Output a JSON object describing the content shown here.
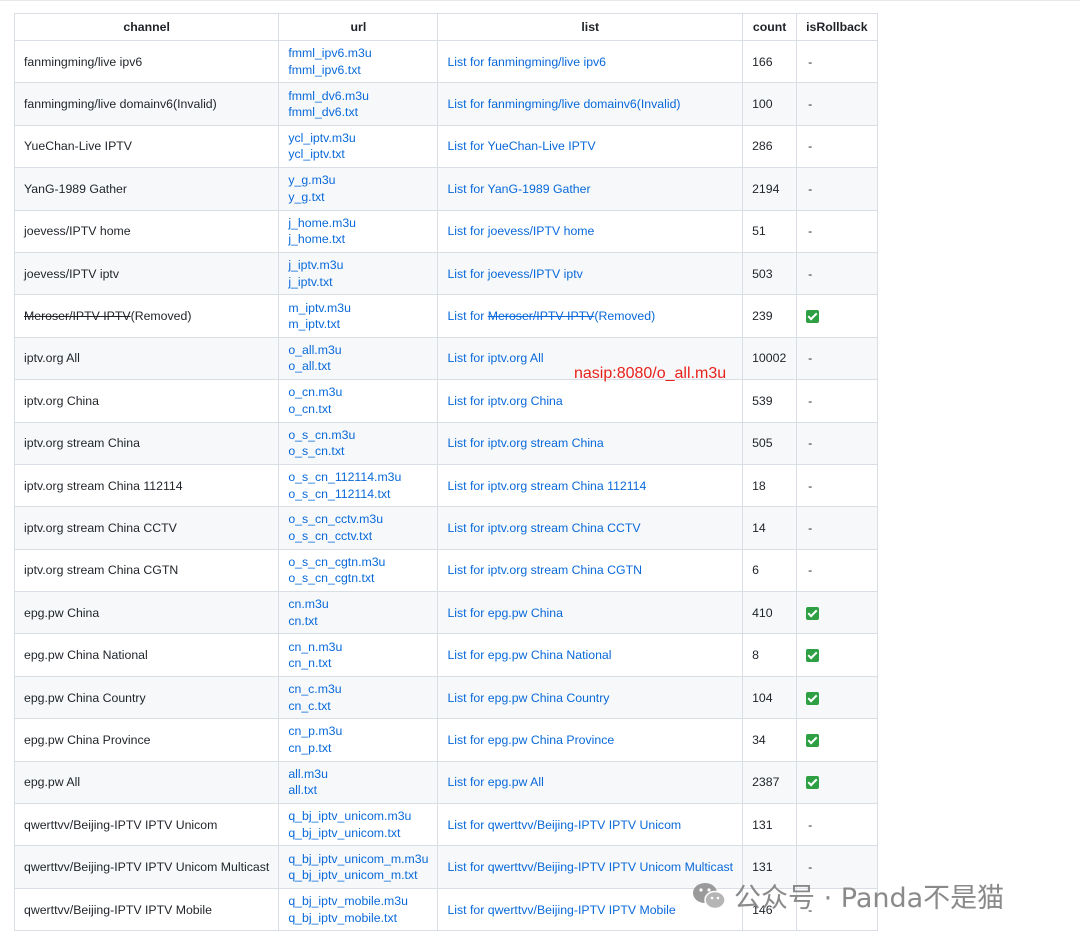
{
  "headers": {
    "channel": "channel",
    "url": "url",
    "list": "list",
    "count": "count",
    "is_rollback": "isRollback"
  },
  "rows": [
    {
      "channel": "fanmingming/live ipv6",
      "url1": "fmml_ipv6.m3u",
      "url2": "fmml_ipv6.txt",
      "list": "List for fanmingming/live ipv6",
      "count": "166",
      "rollback": "-"
    },
    {
      "channel": "fanmingming/live domainv6(Invalid)",
      "url1": "fmml_dv6.m3u",
      "url2": "fmml_dv6.txt",
      "list": "List for fanmingming/live domainv6(Invalid)",
      "count": "100",
      "rollback": "-"
    },
    {
      "channel": "YueChan-Live IPTV",
      "url1": "ycl_iptv.m3u",
      "url2": "ycl_iptv.txt",
      "list": "List for YueChan-Live IPTV",
      "count": "286",
      "rollback": "-"
    },
    {
      "channel": "YanG-1989 Gather",
      "url1": "y_g.m3u",
      "url2": "y_g.txt",
      "list": "List for YanG-1989 Gather",
      "count": "2194",
      "rollback": "-"
    },
    {
      "channel": "joevess/IPTV home",
      "url1": "j_home.m3u",
      "url2": "j_home.txt",
      "list": "List for joevess/IPTV home",
      "count": "51",
      "rollback": "-"
    },
    {
      "channel": "joevess/IPTV iptv",
      "url1": "j_iptv.m3u",
      "url2": "j_iptv.txt",
      "list": "List for joevess/IPTV iptv",
      "count": "503",
      "rollback": "-"
    },
    {
      "channel_strike": "Meroser/IPTV IPTV",
      "channel_suffix": "(Removed)",
      "url1": "m_iptv.m3u",
      "url2": "m_iptv.txt",
      "list_prefix": "List for ",
      "list_strike": "Meroser/IPTV IPTV",
      "list_suffix": "(Removed)",
      "count": "239",
      "rollback": "check"
    },
    {
      "channel": "iptv.org All",
      "url1": "o_all.m3u",
      "url2": "o_all.txt",
      "list": "List for iptv.org All",
      "count": "10002",
      "rollback": "-"
    },
    {
      "channel": "iptv.org China",
      "url1": "o_cn.m3u",
      "url2": "o_cn.txt",
      "list": "List for iptv.org China",
      "count": "539",
      "rollback": "-"
    },
    {
      "channel": "iptv.org stream China",
      "url1": "o_s_cn.m3u",
      "url2": "o_s_cn.txt",
      "list": "List for iptv.org stream China",
      "count": "505",
      "rollback": "-"
    },
    {
      "channel": "iptv.org stream China 112114",
      "url1": "o_s_cn_112114.m3u",
      "url2": "o_s_cn_112114.txt",
      "list": "List for iptv.org stream China 112114",
      "count": "18",
      "rollback": "-"
    },
    {
      "channel": "iptv.org stream China CCTV",
      "url1": "o_s_cn_cctv.m3u",
      "url2": "o_s_cn_cctv.txt",
      "list": "List for iptv.org stream China CCTV",
      "count": "14",
      "rollback": "-"
    },
    {
      "channel": "iptv.org stream China CGTN",
      "url1": "o_s_cn_cgtn.m3u",
      "url2": "o_s_cn_cgtn.txt",
      "list": "List for iptv.org stream China CGTN",
      "count": "6",
      "rollback": "-"
    },
    {
      "channel": "epg.pw China",
      "url1": "cn.m3u",
      "url2": "cn.txt",
      "list": "List for epg.pw China",
      "count": "410",
      "rollback": "check"
    },
    {
      "channel": "epg.pw China National",
      "url1": "cn_n.m3u",
      "url2": "cn_n.txt",
      "list": "List for epg.pw China National",
      "count": "8",
      "rollback": "check"
    },
    {
      "channel": "epg.pw China Country",
      "url1": "cn_c.m3u",
      "url2": "cn_c.txt",
      "list": "List for epg.pw China Country",
      "count": "104",
      "rollback": "check"
    },
    {
      "channel": "epg.pw China Province",
      "url1": "cn_p.m3u",
      "url2": "cn_p.txt",
      "list": "List for epg.pw China Province",
      "count": "34",
      "rollback": "check"
    },
    {
      "channel": "epg.pw All",
      "url1": "all.m3u",
      "url2": "all.txt",
      "list": "List for epg.pw All",
      "count": "2387",
      "rollback": "check"
    },
    {
      "channel": "qwerttvv/Beijing-IPTV IPTV Unicom",
      "url1": "q_bj_iptv_unicom.m3u",
      "url2": "q_bj_iptv_unicom.txt",
      "list": "List for qwerttvv/Beijing-IPTV IPTV Unicom",
      "count": "131",
      "rollback": "-"
    },
    {
      "channel": "qwerttvv/Beijing-IPTV IPTV Unicom Multicast",
      "url1": "q_bj_iptv_unicom_m.m3u",
      "url2": "q_bj_iptv_unicom_m.txt",
      "list": "List for qwerttvv/Beijing-IPTV IPTV Unicom Multicast",
      "count": "131",
      "rollback": "-"
    },
    {
      "channel": "qwerttvv/Beijing-IPTV IPTV Mobile",
      "url1": "q_bj_iptv_mobile.m3u",
      "url2": "q_bj_iptv_mobile.txt",
      "list": "List for qwerttvv/Beijing-IPTV IPTV Mobile",
      "count": "146",
      "rollback": "-"
    }
  ],
  "annotation": "nasip:8080/o_all.m3u",
  "watermark": "公众号 · Panda不是猫",
  "colors": {
    "link": "#0969da",
    "check": "#2ea043",
    "annotation": "#e8221b",
    "border": "#d8dee4",
    "stripe": "#f6f8fa"
  }
}
